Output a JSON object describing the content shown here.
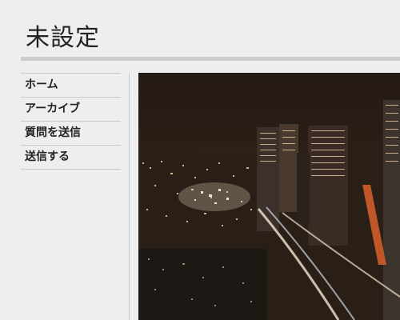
{
  "site": {
    "title": "未設定"
  },
  "nav": {
    "items": [
      {
        "label": "ホーム"
      },
      {
        "label": "アーカイブ"
      },
      {
        "label": "質問を送信"
      },
      {
        "label": "送信する"
      }
    ]
  },
  "content": {
    "image_subject": "tokyo-night-cityscape"
  },
  "colors": {
    "background": "#eeeeee",
    "rule": "#cdcdcd",
    "text": "#222222"
  }
}
